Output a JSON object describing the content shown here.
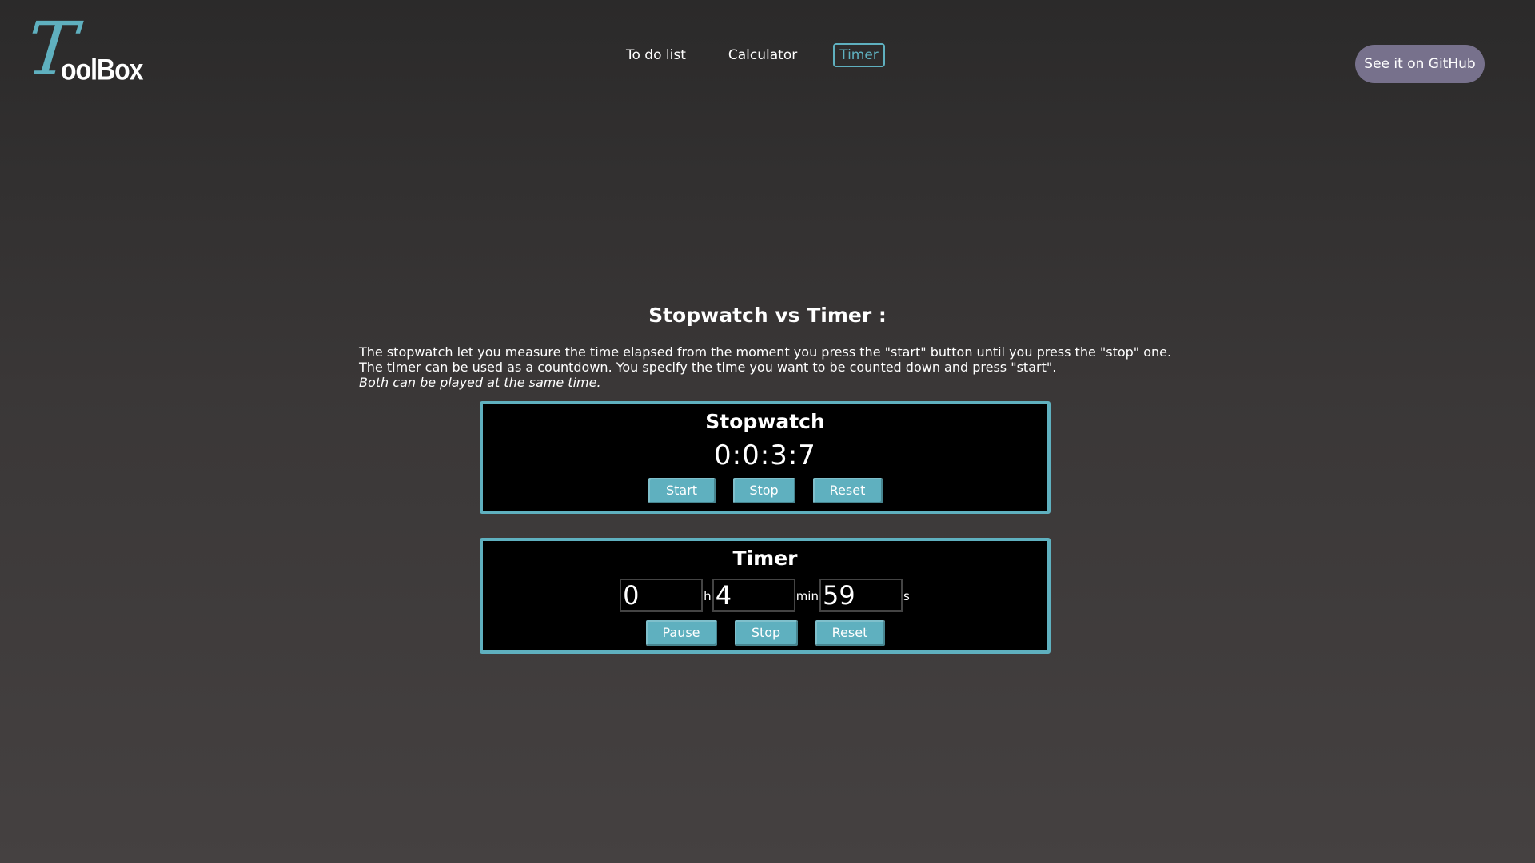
{
  "header": {
    "logo_initial": "T",
    "logo_rest": "oolBox",
    "nav": [
      {
        "label": "To do list",
        "active": false
      },
      {
        "label": "Calculator",
        "active": false
      },
      {
        "label": "Timer",
        "active": true
      }
    ],
    "github_label": "See it on GitHub"
  },
  "main": {
    "heading": "Stopwatch vs Timer :",
    "description": [
      "The stopwatch let you measure the time elapsed from the moment you press the \"start\" button until you press the \"stop\" one.",
      "The timer can be used as a countdown. You specify the time you want to be counted down and press \"start\"."
    ],
    "description_note": "Both can be played at the same time."
  },
  "stopwatch": {
    "title": "Stopwatch",
    "display": "0:0:3:7",
    "buttons": {
      "start": "Start",
      "stop": "Stop",
      "reset": "Reset"
    }
  },
  "timer": {
    "title": "Timer",
    "hours": "0",
    "minutes": "4",
    "seconds": "59",
    "unit_h": "h",
    "unit_min": "min",
    "unit_s": "s",
    "buttons": {
      "pause": "Pause",
      "stop": "Stop",
      "reset": "Reset"
    }
  },
  "colors": {
    "accent": "#5fb0bf",
    "github_button": "#77718c",
    "panel_bg": "#000000"
  }
}
